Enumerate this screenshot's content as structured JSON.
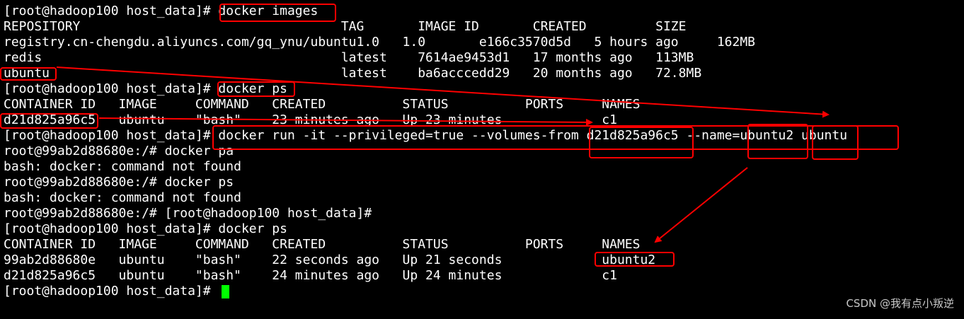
{
  "terminal": {
    "lines": [
      "[root@hadoop100 host_data]# docker images",
      "REPOSITORY                                  TAG       IMAGE ID       CREATED         SIZE",
      "registry.cn-chengdu.aliyuncs.com/gq_ynu/ubuntu1.0   1.0       e166c3570d5d   5 hours ago     162MB",
      "redis                                       latest    7614ae9453d1   17 months ago   113MB",
      "ubuntu                                      latest    ba6acccedd29   20 months ago   72.8MB",
      "[root@hadoop100 host_data]# docker ps",
      "CONTAINER ID   IMAGE     COMMAND   CREATED          STATUS          PORTS     NAMES",
      "d21d825a96c5   ubuntu    \"bash\"    23 minutes ago   Up 23 minutes             c1",
      "[root@hadoop100 host_data]# docker run -it --privileged=true --volumes-from d21d825a96c5 --name=ubuntu2 ubuntu",
      "root@99ab2d88680e:/# docker pa",
      "bash: docker: command not found",
      "root@99ab2d88680e:/# docker ps",
      "bash: docker: command not found",
      "root@99ab2d88680e:/# [root@hadoop100 host_data]#",
      "[root@hadoop100 host_data]# docker ps",
      "CONTAINER ID   IMAGE     COMMAND   CREATED          STATUS          PORTS     NAMES",
      "99ab2d88680e   ubuntu    \"bash\"    22 seconds ago   Up 21 seconds             ubuntu2",
      "d21d825a96c5   ubuntu    \"bash\"    24 minutes ago   Up 24 minutes             c1",
      "[root@hadoop100 host_data]# "
    ],
    "colors": {
      "background": "#000000",
      "text": "#ffffff",
      "cursor": "#00ff00",
      "annotation": "#ff0000"
    }
  },
  "watermark": "CSDN @我有点小叛逆"
}
